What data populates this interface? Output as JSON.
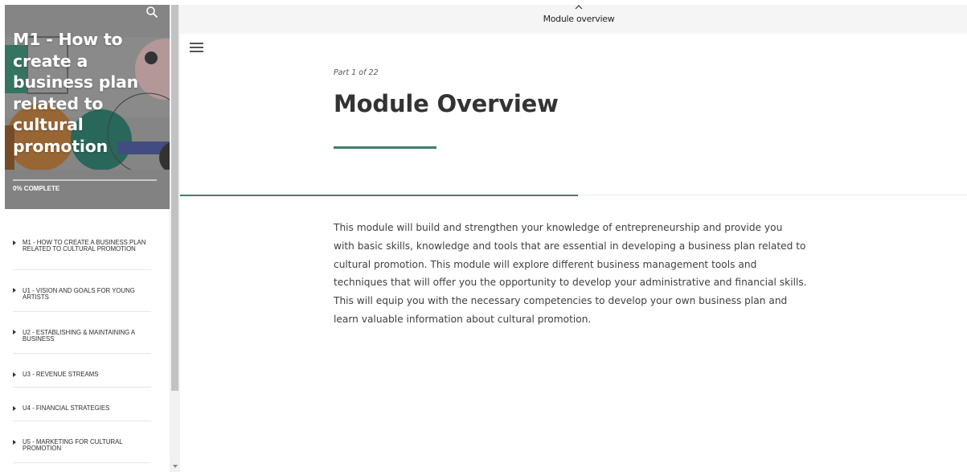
{
  "app": {
    "topbar_title": "Module overview"
  },
  "sidebar": {
    "title": "M1 - How to create a business plan related to cultural promotion",
    "progress_text": "0% COMPLETE",
    "progress": 0,
    "items": [
      {
        "label": "M1 - HOW TO CREATE A BUSINESS PLAN RELATED TO CULTURAL PROMOTION"
      },
      {
        "label": "U1 - VISION AND GOALS FOR YOUNG ARTISTS"
      },
      {
        "label": "U2 - ESTABLISHING & MAINTAINING A BUSINESS"
      },
      {
        "label": "U3 - REVENUE STREAMS"
      },
      {
        "label": "U4 - FINANCIAL STRATEGIES"
      },
      {
        "label": "U5 - MARKETING FOR CULTURAL PROMOTION"
      }
    ]
  },
  "main": {
    "part_label": "Part 1 of 22",
    "title": "Module Overview",
    "body_lines": [
      "This module will build and strengthen your knowledge of entrepreneurship and provide you",
      "with basic skills, knowledge and tools that are essential in developing a business plan related to",
      "cultural promotion. This module will explore different business management tools and",
      "techniques that will offer you the opportunity to develop your administrative and financial skills.",
      "This will equip you with the necessary competencies to develop your own business plan and",
      "learn valuable information about cultural promotion."
    ]
  },
  "colors": {
    "accent": "#3c7f6a",
    "text_dark": "#333333",
    "topbar_bg": "#f5f5f5"
  },
  "icons": {
    "search": "search-icon",
    "menu": "hamburger-menu-icon",
    "collapse": "chevron-up-icon",
    "toc_item": "caret-right-icon"
  }
}
